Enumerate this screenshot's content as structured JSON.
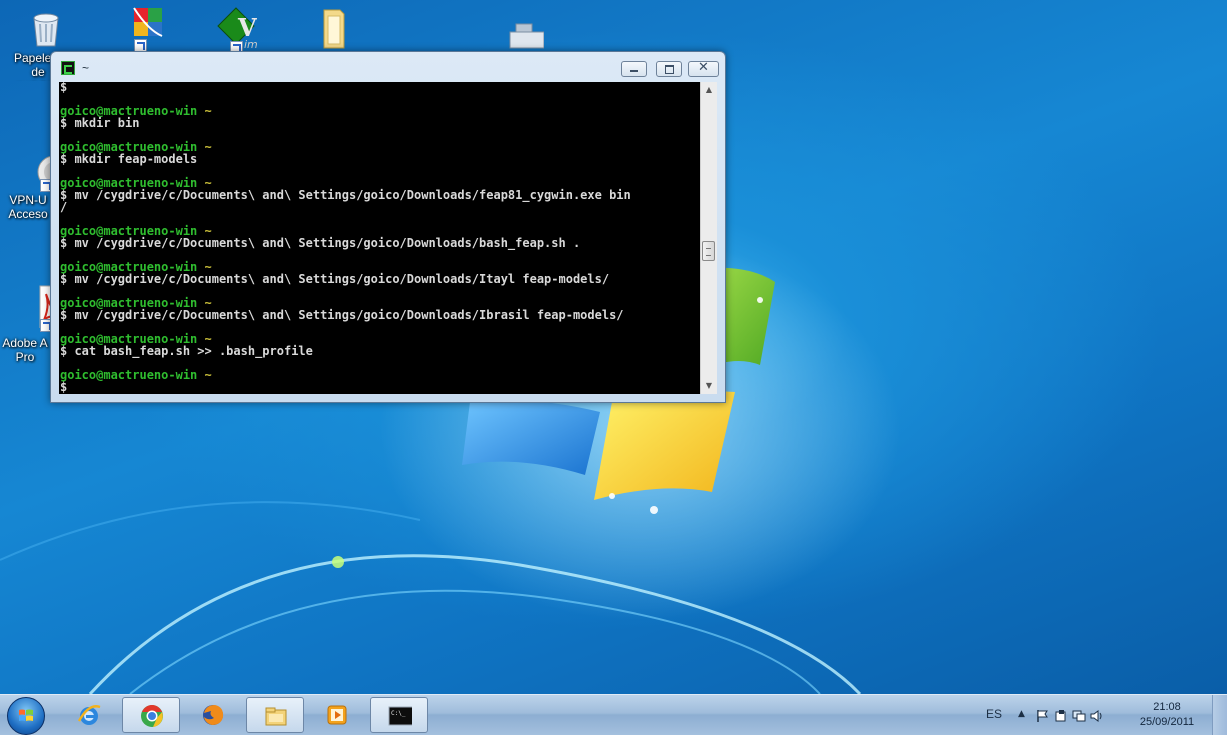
{
  "desktop": {
    "icons": [
      {
        "label": "Papelera de reciclaje",
        "icon": "recycle-bin-icon"
      },
      {
        "label": "",
        "icon": "avg-antivirus-icon"
      },
      {
        "label": "",
        "icon": "gvim-icon"
      },
      {
        "label": "",
        "icon": "folder-icon"
      },
      {
        "label": "",
        "icon": "usb-drive-icon"
      },
      {
        "label": "VPN-U Acceso",
        "icon": "vpn-icon"
      },
      {
        "label": "Adobe A Pro",
        "icon": "adobe-pdf-icon"
      }
    ]
  },
  "window": {
    "title": "~",
    "min_glyph": "",
    "max_glyph": "",
    "close_glyph": "✕"
  },
  "terminal": {
    "lines": [
      {
        "kind": "out",
        "text": "$"
      },
      {
        "kind": "out",
        "text": ""
      },
      {
        "kind": "prompt",
        "user": "goico@mactrueno-win",
        "dir": "~"
      },
      {
        "kind": "out",
        "text": "$ mkdir bin"
      },
      {
        "kind": "out",
        "text": ""
      },
      {
        "kind": "prompt",
        "user": "goico@mactrueno-win",
        "dir": "~"
      },
      {
        "kind": "out",
        "text": "$ mkdir feap-models"
      },
      {
        "kind": "out",
        "text": ""
      },
      {
        "kind": "prompt",
        "user": "goico@mactrueno-win",
        "dir": "~"
      },
      {
        "kind": "out",
        "text": "$ mv /cygdrive/c/Documents\\ and\\ Settings/goico/Downloads/feap81_cygwin.exe bin"
      },
      {
        "kind": "out",
        "text": "/"
      },
      {
        "kind": "out",
        "text": ""
      },
      {
        "kind": "prompt",
        "user": "goico@mactrueno-win",
        "dir": "~"
      },
      {
        "kind": "out",
        "text": "$ mv /cygdrive/c/Documents\\ and\\ Settings/goico/Downloads/bash_feap.sh ."
      },
      {
        "kind": "out",
        "text": ""
      },
      {
        "kind": "prompt",
        "user": "goico@mactrueno-win",
        "dir": "~"
      },
      {
        "kind": "out",
        "text": "$ mv /cygdrive/c/Documents\\ and\\ Settings/goico/Downloads/Itayl feap-models/"
      },
      {
        "kind": "out",
        "text": ""
      },
      {
        "kind": "prompt",
        "user": "goico@mactrueno-win",
        "dir": "~"
      },
      {
        "kind": "out",
        "text": "$ mv /cygdrive/c/Documents\\ and\\ Settings/goico/Downloads/Ibrasil feap-models/"
      },
      {
        "kind": "out",
        "text": ""
      },
      {
        "kind": "prompt",
        "user": "goico@mactrueno-win",
        "dir": "~"
      },
      {
        "kind": "out",
        "text": "$ cat bash_feap.sh >> .bash_profile"
      },
      {
        "kind": "out",
        "text": ""
      },
      {
        "kind": "prompt",
        "user": "goico@mactrueno-win",
        "dir": "~"
      },
      {
        "kind": "out",
        "text": "$"
      }
    ],
    "scroll_position": 0.55
  },
  "taskbar": {
    "pinned": [
      {
        "name": "internet-explorer-icon",
        "active": false
      },
      {
        "name": "chrome-icon",
        "active": true
      },
      {
        "name": "firefox-icon",
        "active": false
      },
      {
        "name": "file-explorer-icon",
        "active": true
      },
      {
        "name": "media-player-icon",
        "active": false
      },
      {
        "name": "console-icon",
        "active": true
      }
    ],
    "tray": {
      "language": "ES",
      "time": "21:08",
      "date": "25/09/2011"
    }
  },
  "colors": {
    "prompt_user": "#2fbd2f",
    "prompt_dir": "#c9bf3a",
    "terminal_bg": "#000000",
    "terminal_text": "#d9d9d9"
  }
}
